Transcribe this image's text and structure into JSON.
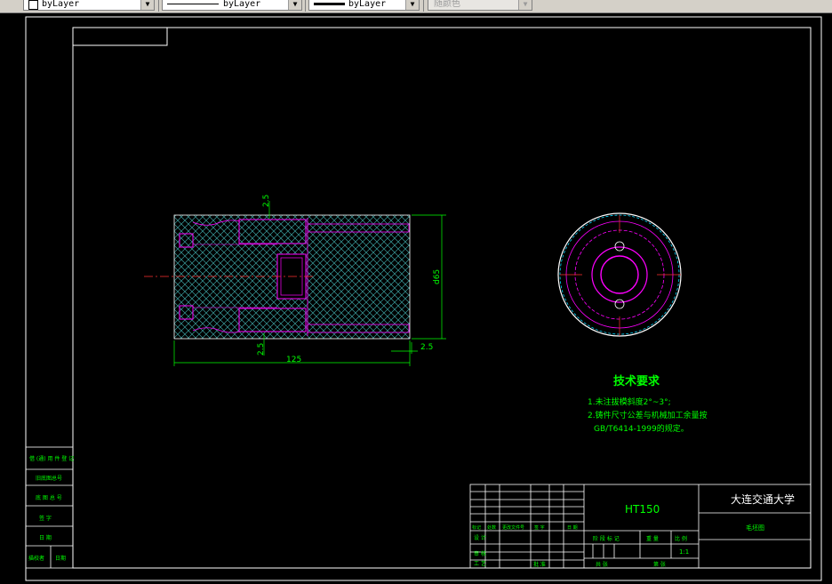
{
  "toolbar": {
    "layer_color": "byLayer",
    "linetype": "byLayer",
    "lineweight": "byLayer",
    "plot_style": "随颜色"
  },
  "drawing": {
    "dimensions": {
      "top_step": "2.5",
      "bottom_step": "2.5",
      "right_offset": "2.5",
      "length": "125",
      "diameter": "d65"
    },
    "tech_requirements": {
      "title": "技术要求",
      "line1": "1.未注拔模斜度2°~3°;",
      "line2": "2.铸件尺寸公差与机械加工余量按",
      "line3": "GB/T6414-1999的规定。"
    },
    "title_block": {
      "material": "HT150",
      "university": "大连交通大学",
      "part_name": "毛坯图",
      "scale": "1:1",
      "header_labels": [
        "标记",
        "处数",
        "更改文件号",
        "签 字",
        "日 期"
      ],
      "design_label": "设 计",
      "review_label": "审 核",
      "process_label": "工 艺",
      "approve_label": "批 准",
      "stage_label": "阶 段 标 记",
      "weight_label": "重 量",
      "ratio_label": "比 例",
      "sheet_label": "共 张",
      "sheet_of_label": "第 张"
    },
    "side_block": {
      "rows": [
        "借 (通) 用 件 登 记",
        "旧底图总号",
        "底 图 总 号",
        "签  字",
        "日  期",
        "描校者",
        "日期"
      ]
    }
  }
}
